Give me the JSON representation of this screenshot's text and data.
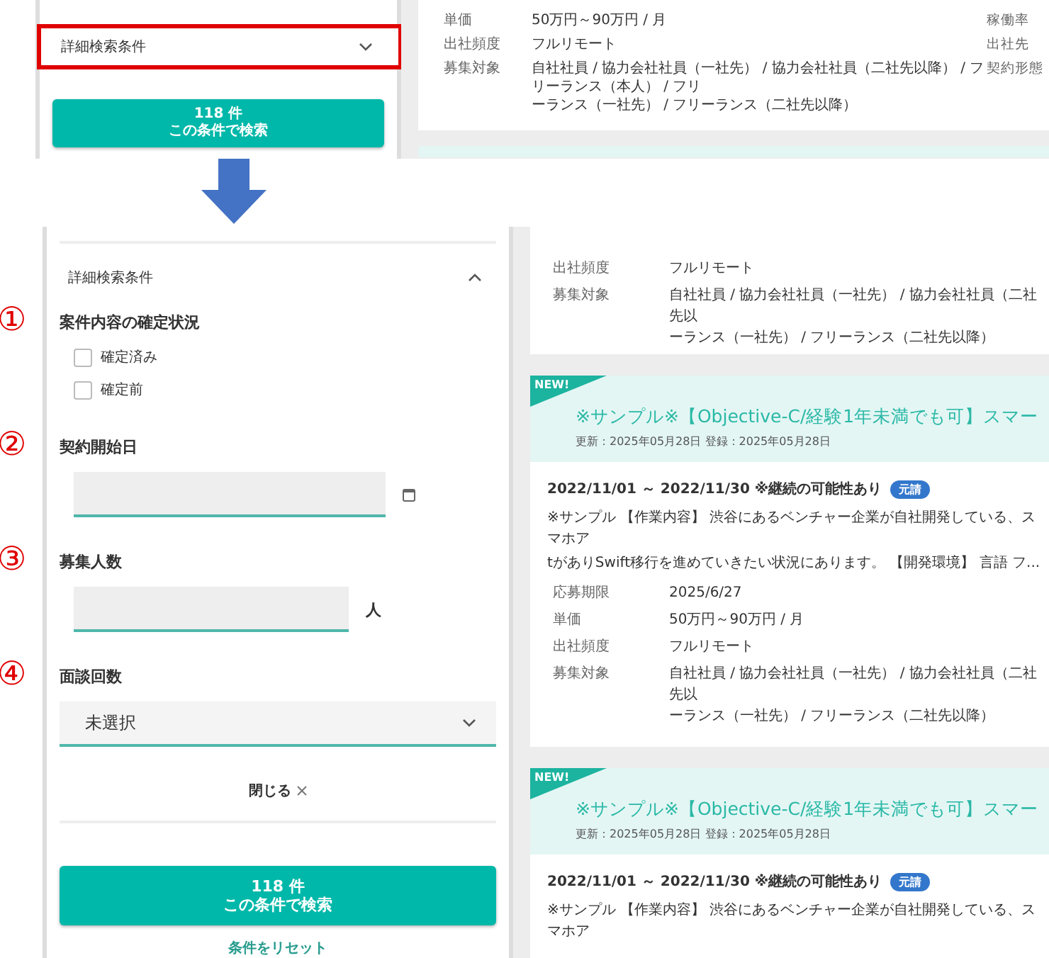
{
  "before": {
    "sidebar": {
      "detail_toggle": {
        "label": "詳細検索条件",
        "expanded": false,
        "highlighted": true
      },
      "search_button": {
        "count": "118 件",
        "label": "この条件で検索"
      }
    },
    "listing": {
      "rows": [
        {
          "label": "単価",
          "value_lines": [
            "50万円～90万円 / 月"
          ],
          "side_label": "稼働率"
        },
        {
          "label": "出社頻度",
          "value_lines": [
            "フルリモート"
          ],
          "side_label": "出社先"
        },
        {
          "label": "募集対象",
          "value_lines": [
            "自社社員 / 協力会社社員（一社先） / 協力会社社員（二社先以降） / フリーランス（本人） / フリ",
            "ーランス（一社先） / フリーランス（二社先以降）"
          ],
          "side_label": "契約形態"
        }
      ]
    }
  },
  "after": {
    "sidebar": {
      "detail_toggle": {
        "label": "詳細検索条件",
        "expanded": true
      },
      "sections": [
        {
          "marker": "①",
          "title": "案件内容の確定状況",
          "kind": "checkboxes",
          "options": [
            {
              "label": "確定済み",
              "checked": false
            },
            {
              "label": "確定前",
              "checked": false
            }
          ]
        },
        {
          "marker": "②",
          "title": "契約開始日",
          "kind": "date"
        },
        {
          "marker": "③",
          "title": "募集人数",
          "kind": "number",
          "unit": "人"
        },
        {
          "marker": "④",
          "title": "面談回数",
          "kind": "select",
          "value": "未選択"
        }
      ],
      "close_label": "閉じる",
      "search_button": {
        "count": "118 件",
        "label": "この条件で検索"
      },
      "reset_link": "条件をリセット"
    },
    "listing": {
      "partial_rows": [
        {
          "label": "出社頻度",
          "value_lines": [
            "フルリモート"
          ]
        },
        {
          "label": "募集対象",
          "value_lines": [
            "自社社員 / 協力会社社員（一社先） / 協力会社社員（二社先以",
            "ーランス（一社先） / フリーランス（二社先以降）"
          ]
        }
      ],
      "cards": [
        {
          "badge": "NEW!",
          "title": "※サンプル※【Objective-C/経験1年未満でも可】スマー",
          "dates": "更新：2025年05月28日 登録：2025年05月28日",
          "period": "2022/11/01 ～ 2022/11/30 ※継続の可能性あり",
          "tag": "元請",
          "description_lines": [
            "※サンプル 【作業内容】 渋谷にあるベンチャー企業が自社開発している、スマホア",
            "tがありSwift移行を進めていきたい状況にあります。 【開発環境】 言語 フ..."
          ],
          "rows": [
            {
              "label": "応募期限",
              "value_lines": [
                "2025/6/27"
              ]
            },
            {
              "label": "単価",
              "value_lines": [
                "50万円～90万円 / 月"
              ]
            },
            {
              "label": "出社頻度",
              "value_lines": [
                "フルリモート"
              ]
            },
            {
              "label": "募集対象",
              "value_lines": [
                "自社社員 / 協力会社社員（一社先） / 協力会社社員（二社先以",
                "ーランス（一社先） / フリーランス（二社先以降）"
              ]
            }
          ]
        },
        {
          "badge": "NEW!",
          "title": "※サンプル※【Objective-C/経験1年未満でも可】スマー",
          "dates": "更新：2025年05月28日 登録：2025年05月28日",
          "period": "2022/11/01 ～ 2022/11/30 ※継続の可能性あり",
          "tag": "元請",
          "description_lines": [
            "※サンプル 【作業内容】 渋谷にあるベンチャー企業が自社開発している、スマホア"
          ]
        }
      ]
    }
  }
}
